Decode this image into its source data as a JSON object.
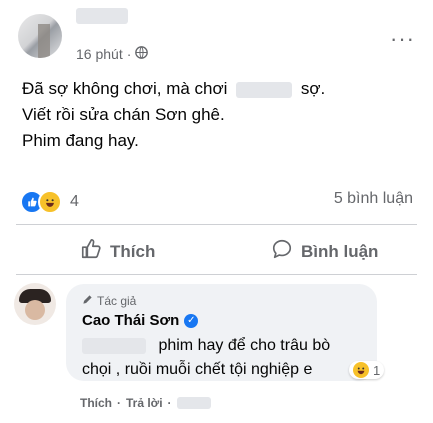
{
  "post": {
    "time": "16 phút",
    "separator": "·",
    "privacy_icon": "globe-icon",
    "more_label": "···",
    "lines": {
      "l1_before": "Đã sợ không chơi, mà chơi",
      "l1_after": "sợ.",
      "l2": "Viết rồi sửa chán Sơn ghê.",
      "l3": "Phim đang hay."
    },
    "reaction_count": "4",
    "comment_count": "5 bình luận",
    "like_label": "Thích",
    "comment_label": "Bình luận"
  },
  "comment": {
    "author_tag": "Tác giả",
    "author_name": "Cao Thái Sơn",
    "line1": "phim hay để cho trâu bò",
    "line2": "chọi , ruồi muỗi chết tội nghiệp e",
    "reaction_count": "1",
    "like_action": "Thích",
    "reply_action": "Trả lời",
    "dot": "·"
  },
  "colors": {
    "accent": "#1877f2",
    "muted": "#65676b",
    "bubble": "#f0f2f5"
  }
}
